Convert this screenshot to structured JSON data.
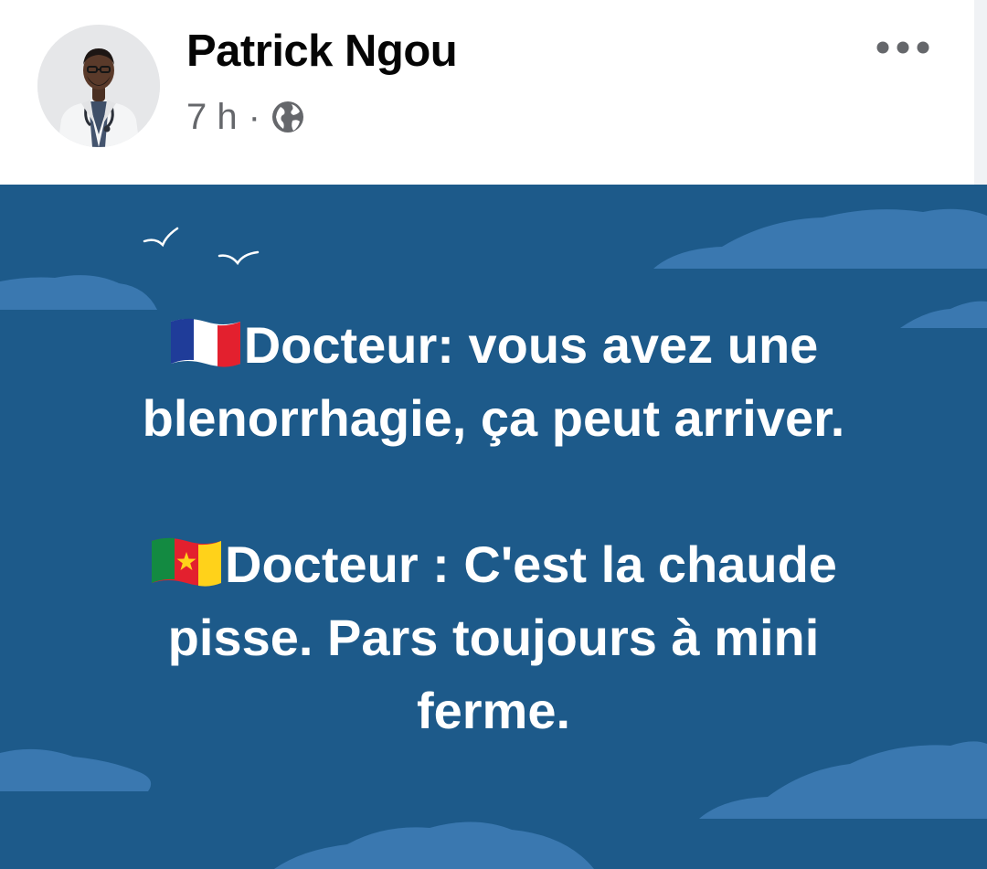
{
  "post": {
    "author_name": "Patrick Ngou",
    "timestamp": "7 h",
    "separator": "·",
    "privacy_icon": "globe-icon",
    "more_icon": "more-horizontal-icon"
  },
  "image": {
    "background_color": "#1d5a8a",
    "cloud_color": "#3a78b0",
    "paragraph1": {
      "flag_icon": "flag-france-icon",
      "line1": "Docteur: vous avez une",
      "line2": "blenorrhagie, ça peut arriver."
    },
    "paragraph2": {
      "flag_icon": "flag-cameroon-icon",
      "line1": "Docteur : C'est la chaude",
      "line2": "pisse. Pars toujours à mini",
      "line3": "ferme."
    }
  },
  "colors": {
    "name_text": "#050505",
    "meta_text": "#65676b",
    "post_text": "#ffffff"
  }
}
